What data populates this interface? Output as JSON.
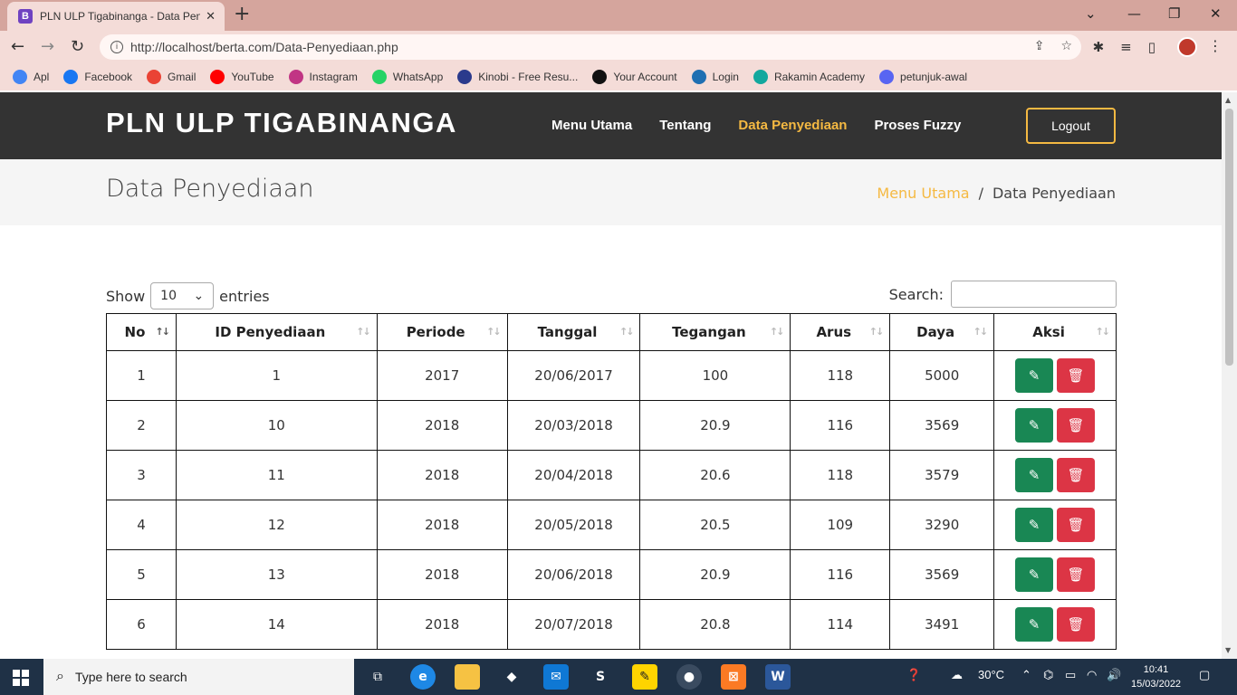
{
  "browser": {
    "tab_title": "PLN ULP Tigabinanga - Data Penyediaan",
    "tab_favicon": "B",
    "url": "http://localhost/berta.com/Data-Penyediaan.php",
    "bookmarks": [
      {
        "label": "Apl",
        "icon": "apps-grid-icon",
        "color": "#4285f4"
      },
      {
        "label": "Facebook",
        "icon": "facebook-icon",
        "color": "#1877f2"
      },
      {
        "label": "Gmail",
        "icon": "gmail-icon",
        "color": "#ea4335"
      },
      {
        "label": "YouTube",
        "icon": "youtube-icon",
        "color": "#ff0000"
      },
      {
        "label": "Instagram",
        "icon": "instagram-icon",
        "color": "#c13584"
      },
      {
        "label": "WhatsApp",
        "icon": "whatsapp-icon",
        "color": "#25d366"
      },
      {
        "label": "Kinobi - Free Resu...",
        "icon": "kinobi-icon",
        "color": "#2b3a8c"
      },
      {
        "label": "Your Account",
        "icon": "amazon-icon",
        "color": "#111111"
      },
      {
        "label": "Login",
        "icon": "login-icon",
        "color": "#1f6fb2"
      },
      {
        "label": "Rakamin Academy",
        "icon": "rakamin-icon",
        "color": "#13a89e"
      },
      {
        "label": "petunjuk-awal",
        "icon": "discord-icon",
        "color": "#5865f2"
      }
    ]
  },
  "site": {
    "brand": "PLN ULP TIGABINANGA",
    "nav": [
      "Menu Utama",
      "Tentang",
      "Data Penyediaan",
      "Proses Fuzzy"
    ],
    "active_nav": "Data Penyediaan",
    "logout_label": "Logout",
    "accent": "#f5b942"
  },
  "page": {
    "title": "Data Penyediaan",
    "breadcrumb_home": "Menu Utama",
    "breadcrumb_sep": "/",
    "breadcrumb_current": "Data Penyediaan"
  },
  "table_controls": {
    "show_label": "Show",
    "page_length": "10",
    "entries_label": "entries",
    "search_label": "Search:"
  },
  "table": {
    "columns": [
      "No",
      "ID Penyediaan",
      "Periode",
      "Tanggal",
      "Tegangan",
      "Arus",
      "Daya",
      "Aksi"
    ],
    "rows": [
      {
        "no": "1",
        "id": "1",
        "periode": "2017",
        "tanggal": "20/06/2017",
        "tegangan": "100",
        "arus": "118",
        "daya": "5000"
      },
      {
        "no": "2",
        "id": "10",
        "periode": "2018",
        "tanggal": "20/03/2018",
        "tegangan": "20.9",
        "arus": "116",
        "daya": "3569"
      },
      {
        "no": "3",
        "id": "11",
        "periode": "2018",
        "tanggal": "20/04/2018",
        "tegangan": "20.6",
        "arus": "118",
        "daya": "3579"
      },
      {
        "no": "4",
        "id": "12",
        "periode": "2018",
        "tanggal": "20/05/2018",
        "tegangan": "20.5",
        "arus": "109",
        "daya": "3290"
      },
      {
        "no": "5",
        "id": "13",
        "periode": "2018",
        "tanggal": "20/06/2018",
        "tegangan": "20.9",
        "arus": "116",
        "daya": "3569"
      },
      {
        "no": "6",
        "id": "14",
        "periode": "2018",
        "tanggal": "20/07/2018",
        "tegangan": "20.8",
        "arus": "114",
        "daya": "3491"
      }
    ],
    "edit_color": "#198754",
    "delete_color": "#dc3545"
  },
  "taskbar": {
    "search_placeholder": "Type here to search",
    "weather": "30°C",
    "time": "10:41",
    "date": "15/03/2022"
  }
}
